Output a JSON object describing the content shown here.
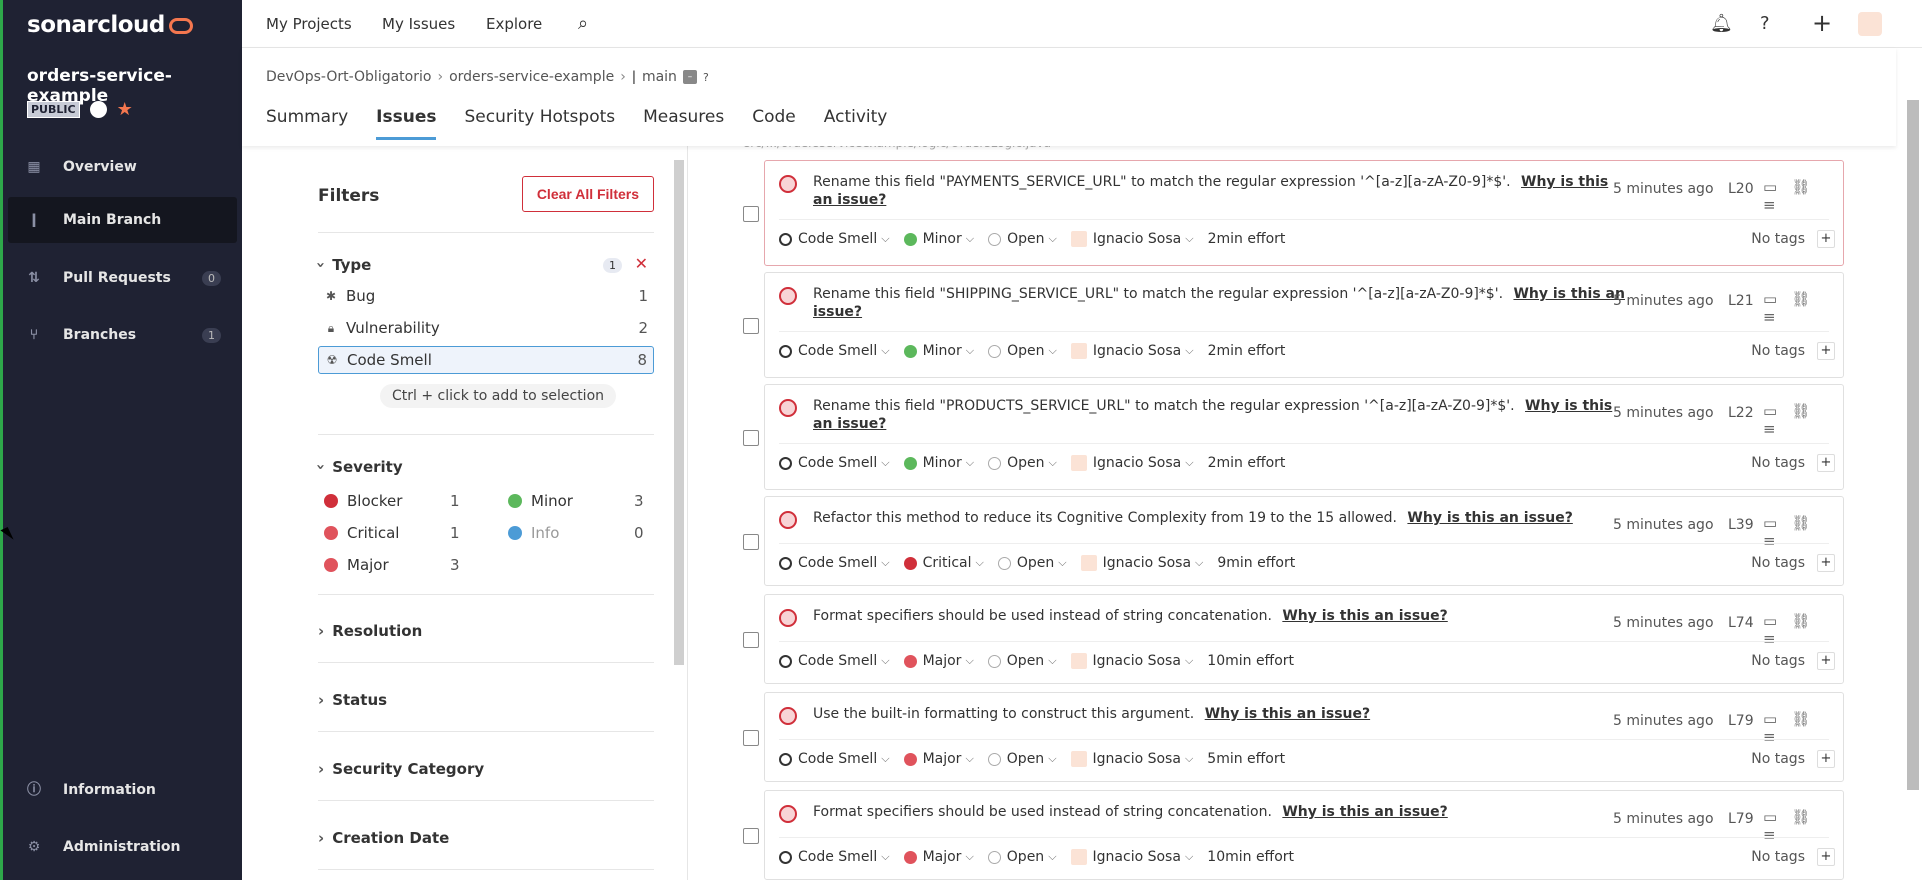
{
  "sidebar": {
    "logo": "sonarcloud",
    "project_name": "orders-service-example",
    "visibility": "PUBLIC",
    "nav": [
      {
        "label": "Overview",
        "icon": "overview-icon"
      },
      {
        "label": "Main Branch",
        "icon": "branch-icon",
        "active": true
      },
      {
        "label": "Pull Requests",
        "icon": "pull-request-icon",
        "count": "0"
      },
      {
        "label": "Branches",
        "icon": "branches-icon",
        "count": "1"
      }
    ],
    "bottom": [
      {
        "label": "Information",
        "icon": "info-icon"
      },
      {
        "label": "Administration",
        "icon": "gear-icon"
      }
    ]
  },
  "topnav": {
    "links": [
      "My Projects",
      "My Issues",
      "Explore"
    ]
  },
  "breadcrumb": {
    "org": "DevOps-Ort-Obligatorio",
    "project": "orders-service-example",
    "branch": "main"
  },
  "tabs": [
    "Summary",
    "Issues",
    "Security Hotspots",
    "Measures",
    "Code",
    "Activity"
  ],
  "filters": {
    "title": "Filters",
    "clear_label": "Clear All Filters",
    "type": {
      "label": "Type",
      "selected_count": "1",
      "items": [
        {
          "label": "Bug",
          "count": "1"
        },
        {
          "label": "Vulnerability",
          "count": "2"
        },
        {
          "label": "Code Smell",
          "count": "8"
        }
      ],
      "hint": "Ctrl + click to add to selection"
    },
    "severity": {
      "label": "Severity",
      "items": [
        {
          "label": "Blocker",
          "count": "1"
        },
        {
          "label": "Minor",
          "count": "3"
        },
        {
          "label": "Critical",
          "count": "1"
        },
        {
          "label": "Info",
          "count": "0"
        },
        {
          "label": "Major",
          "count": "3"
        }
      ]
    },
    "collapsed": [
      "Resolution",
      "Status",
      "Security Category",
      "Creation Date"
    ]
  },
  "issues": {
    "file_hint": "src/.../ordersserviceexample/logic/OrdersLogic.java",
    "why_label": "Why is this an issue?",
    "tags_label": "No tags",
    "items": [
      {
        "message": "Rename this field \"PAYMENTS_SERVICE_URL\" to match the regular expression '^[a-z][a-zA-Z0-9]*$'.",
        "why1": "Why is this",
        "why2": "an issue?",
        "time": "5 minutes ago",
        "line": "L20",
        "type": "Code Smell",
        "severity": "Minor",
        "status": "Open",
        "assignee": "Ignacio Sosa",
        "effort": "2min effort"
      },
      {
        "message": "Rename this field \"SHIPPING_SERVICE_URL\" to match the regular expression '^[a-z][a-zA-Z0-9]*$'.",
        "why1": "Why is this an",
        "why2": "issue?",
        "time": "5 minutes ago",
        "line": "L21",
        "type": "Code Smell",
        "severity": "Minor",
        "status": "Open",
        "assignee": "Ignacio Sosa",
        "effort": "2min effort"
      },
      {
        "message": "Rename this field \"PRODUCTS_SERVICE_URL\" to match the regular expression '^[a-z][a-zA-Z0-9]*$'.",
        "why1": "Why is this",
        "why2": "an issue?",
        "time": "5 minutes ago",
        "line": "L22",
        "type": "Code Smell",
        "severity": "Minor",
        "status": "Open",
        "assignee": "Ignacio Sosa",
        "effort": "2min effort"
      },
      {
        "message": "Refactor this method to reduce its Cognitive Complexity from 19 to the 15 allowed.",
        "why1": "Why is this an issue?",
        "why2": "",
        "time": "5 minutes ago",
        "line": "L39",
        "type": "Code Smell",
        "severity": "Critical",
        "status": "Open",
        "assignee": "Ignacio Sosa",
        "effort": "9min effort"
      },
      {
        "message": "Format specifiers should be used instead of string concatenation.",
        "why1": "Why is this an issue?",
        "why2": "",
        "time": "5 minutes ago",
        "line": "L74",
        "type": "Code Smell",
        "severity": "Major",
        "status": "Open",
        "assignee": "Ignacio Sosa",
        "effort": "10min effort"
      },
      {
        "message": "Use the built-in formatting to construct this argument.",
        "why1": "Why is this an issue?",
        "why2": "",
        "time": "5 minutes ago",
        "line": "L79",
        "type": "Code Smell",
        "severity": "Major",
        "status": "Open",
        "assignee": "Ignacio Sosa",
        "effort": "5min effort"
      },
      {
        "message": "Format specifiers should be used instead of string concatenation.",
        "why1": "Why is this an issue?",
        "why2": "",
        "time": "5 minutes ago",
        "line": "L79",
        "type": "Code Smell",
        "severity": "Major",
        "status": "Open",
        "assignee": "Ignacio Sosa",
        "effort": "10min effort"
      }
    ]
  },
  "colors": {
    "accent": "#4c9bd6",
    "danger": "#d02f3a",
    "minor": "#5cb85c",
    "sidebar": "#1f2233",
    "orange": "#f4774f"
  }
}
